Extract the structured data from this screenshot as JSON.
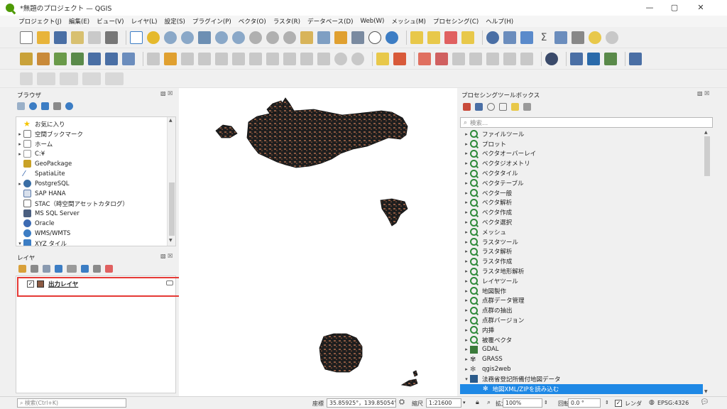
{
  "window": {
    "title": "*無題のプロジェクト — QGIS",
    "minimize_glyph": "—",
    "maximize_glyph": "▢",
    "close_glyph": "✕"
  },
  "menu": [
    "プロジェクト(J)",
    "編集(E)",
    "ビュー(V)",
    "レイヤ(L)",
    "設定(S)",
    "プラグイン(P)",
    "ベクタ(O)",
    "ラスタ(R)",
    "データベース(D)",
    "Web(W)",
    "メッシュ(M)",
    "プロセシング(C)",
    "ヘルプ(H)"
  ],
  "browser": {
    "title": "ブラウザ",
    "items": [
      {
        "label": "お気に入り",
        "icon": "star-icon",
        "color": "#f5c400"
      },
      {
        "label": "空間ブックマーク",
        "icon": "bookmark-icon",
        "color": "#777777"
      },
      {
        "label": "ホーム",
        "icon": "home-folder-icon",
        "color": "#888888"
      },
      {
        "label": "C:¥",
        "icon": "drive-icon",
        "color": "#999999"
      },
      {
        "label": "GeoPackage",
        "icon": "geopackage-icon",
        "color": "#c9a227"
      },
      {
        "label": "SpatiaLite",
        "icon": "spatialite-icon",
        "color": "#2b5ea8"
      },
      {
        "label": "PostgreSQL",
        "icon": "postgresql-icon",
        "color": "#3a6ea5"
      },
      {
        "label": "SAP HANA",
        "icon": "sap-hana-icon",
        "color": "#5a79a8"
      },
      {
        "label": "STAC（時空間アセットカタログ）",
        "icon": "stac-icon",
        "color": "#666666"
      },
      {
        "label": "MS SQL Server",
        "icon": "mssql-icon",
        "color": "#4b5f80"
      },
      {
        "label": "Oracle",
        "icon": "oracle-icon",
        "color": "#3d6bb3"
      },
      {
        "label": "WMS/WMTS",
        "icon": "wms-icon",
        "color": "#3c7dc4"
      },
      {
        "label": "XYZ タイル",
        "icon": "xyz-tiles-icon",
        "color": "#3c7dc4"
      }
    ]
  },
  "layers": {
    "title": "レイヤ",
    "items": [
      {
        "label": "出力レイヤ",
        "checked": "✓",
        "color": "#8c5a43"
      }
    ]
  },
  "processing": {
    "title": "プロセシングツールボックス",
    "search_placeholder": "検索...",
    "items": [
      "ファイルツール",
      "プロット",
      "ベクタオーバーレイ",
      "ベクタジオメトリ",
      "ベクタタイル",
      "ベクタテーブル",
      "ベクタ一般",
      "ベクタ解析",
      "ベクタ作成",
      "ベクタ選択",
      "メッシュ",
      "ラスタツール",
      "ラスタ解析",
      "ラスタ作成",
      "ラスタ地形解析",
      "レイヤツール",
      "地図製作",
      "点群データ管理",
      "点群の抽出",
      "点群バージョン",
      "内挿",
      "被覆ベクタ"
    ],
    "providers": [
      {
        "label": "GDAL",
        "icon": "gdal-icon"
      },
      {
        "label": "GRASS",
        "icon": "grass-icon"
      },
      {
        "label": "qgis2web",
        "icon": "qgis2web-icon"
      },
      {
        "label": "法務省登記所備付地図データ",
        "icon": "plugin-icon"
      }
    ],
    "selected_tool": "地図XML/ZIPを読み込む"
  },
  "statusbar": {
    "search_placeholder": "検索(Ctrl+K)",
    "coord_label": "座標",
    "coord_value": "35.85925°，139.85054°",
    "scale_label": "縮尺",
    "scale_value": "1:21600",
    "magnifier_label": "拡大",
    "magnifier_value": "100%",
    "rotation_label": "回転",
    "rotation_value": "0.0 °",
    "render_label": "レンダ",
    "crs_label": "EPSG:4326"
  },
  "colors": {
    "feature_fill": "#8c5a43",
    "feature_stroke": "#1b1b1b",
    "highlight": "#e53935",
    "selection": "#1e88e5"
  }
}
